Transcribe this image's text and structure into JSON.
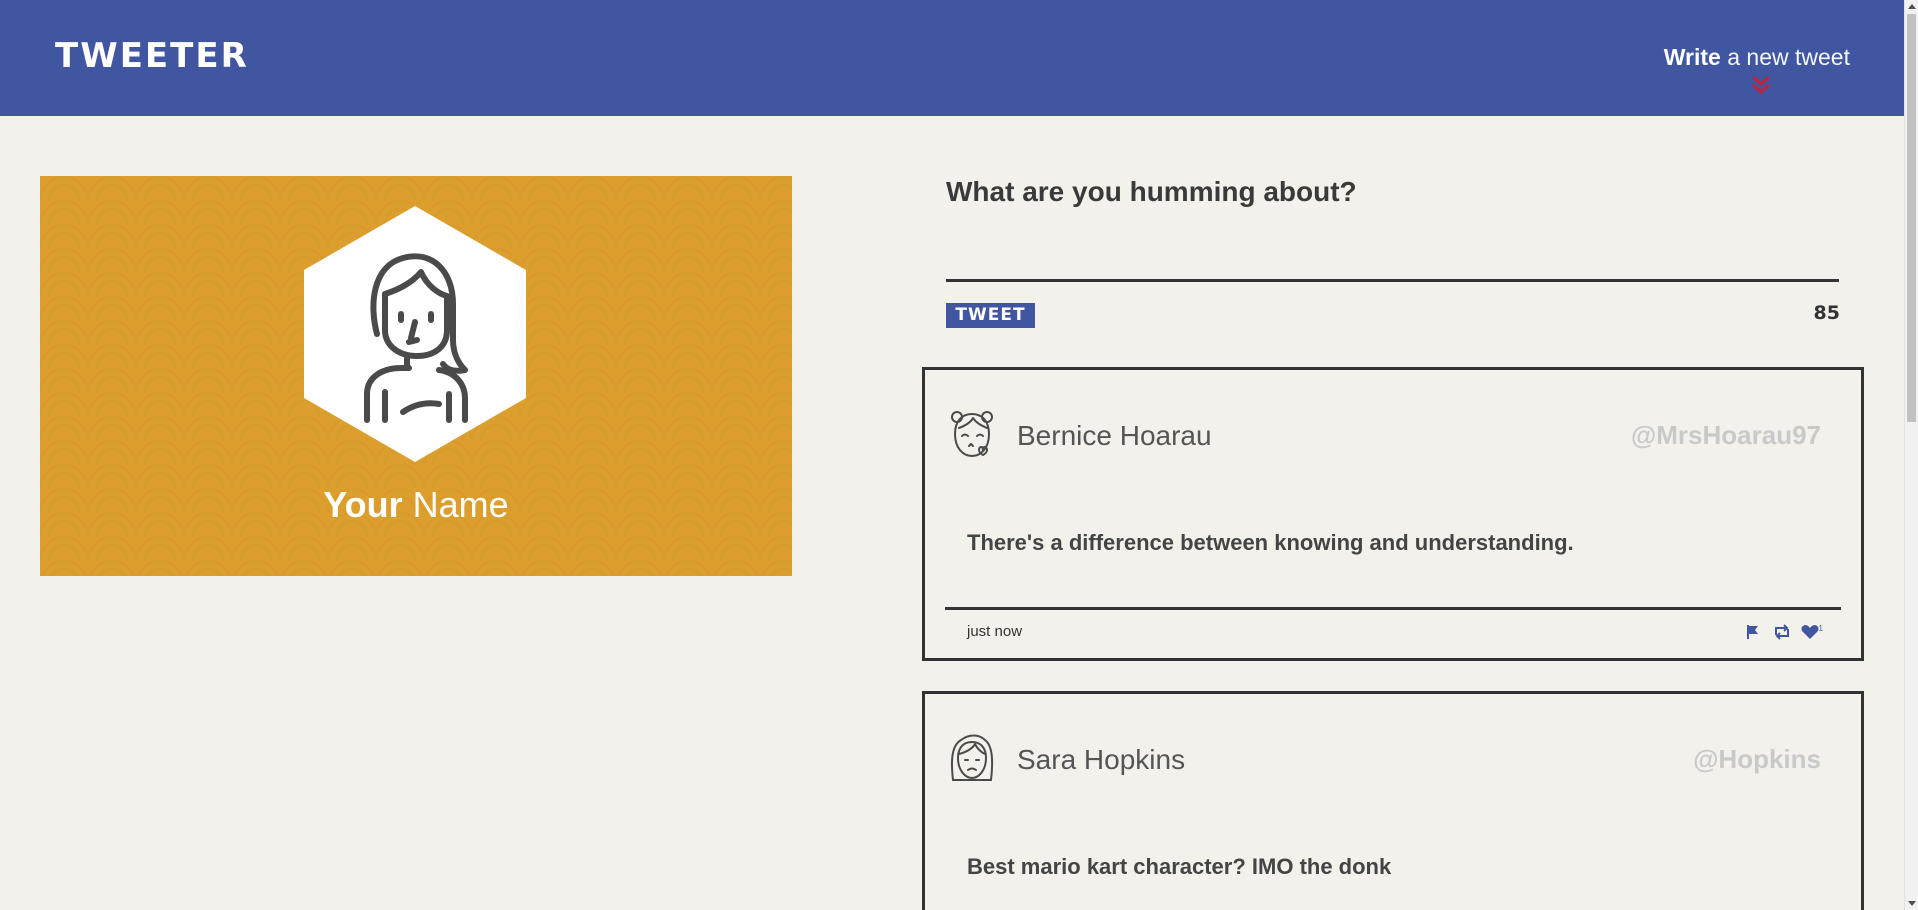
{
  "nav": {
    "logo": "TWEETER",
    "compose_bold": "Write",
    "compose_rest": "a new tweet",
    "chevron_icon": "double-chevron-down-icon",
    "chevron_color": "#c0233a"
  },
  "colors": {
    "nav_bg": "#4056a1",
    "page_bg": "#f3f1ec",
    "profile_bg": "#dc9e2c",
    "text_dark": "#333333",
    "handle": "#c9c9c9"
  },
  "profile": {
    "name_bold": "Your",
    "name_rest": "Name",
    "avatar_icon": "woman-avatar-icon"
  },
  "compose": {
    "prompt": "What are you humming about?",
    "input_value": "",
    "button_label": "TWEET",
    "counter": "85"
  },
  "tweets": [
    {
      "name": "Bernice Hoarau",
      "handle": "@MrsHoarau97",
      "body": "There's a difference between knowing and understanding.",
      "time": "just now",
      "avatar_icon": "girl-kiss-avatar-icon",
      "like_count": "1"
    },
    {
      "name": "Sara Hopkins",
      "handle": "@Hopkins",
      "body": "Best mario kart character? IMO the donk",
      "avatar_icon": "woman-sad-avatar-icon"
    }
  ]
}
